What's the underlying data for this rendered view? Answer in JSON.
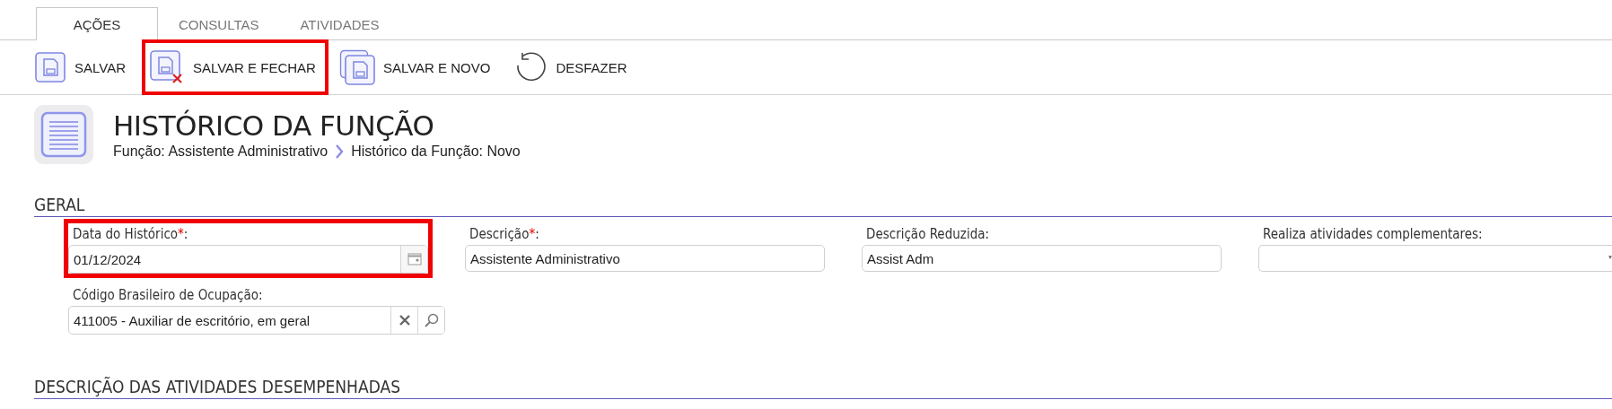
{
  "tabs": [
    {
      "label": "AÇÕES",
      "selected": true
    },
    {
      "label": "CONSULTAS",
      "selected": false
    },
    {
      "label": "ATIVIDADES",
      "selected": false
    }
  ],
  "toolbar": [
    {
      "kind": "save",
      "label": "SALVAR",
      "highlighted": false
    },
    {
      "kind": "save-close",
      "label": "SALVAR E FECHAR",
      "highlighted": true
    },
    {
      "kind": "save-new",
      "label": "SALVAR E NOVO",
      "highlighted": false
    },
    {
      "kind": "undo",
      "label": "DESFAZER",
      "highlighted": false
    }
  ],
  "header": {
    "title": "HISTÓRICO DA FUNÇÃO",
    "breadcrumb": [
      "Função: Assistente Administrativo",
      "Histórico da Função: Novo"
    ]
  },
  "sections": [
    {
      "title": "GERAL",
      "rows": [
        [
          {
            "kind": "date",
            "label": "Data do Histórico",
            "required_mark": "*",
            "label_suffix": ":",
            "value": "01/12/2024",
            "highlighted": true
          },
          {
            "kind": "text",
            "label": "Descrição",
            "required_mark": "*",
            "label_suffix": ":",
            "value": "Assistente Administrativo",
            "highlighted": false
          },
          {
            "kind": "text",
            "label": "Descrição Reduzida:",
            "value": "Assist Adm",
            "highlighted": false
          },
          {
            "kind": "select",
            "label": "Realiza atividades complementares:",
            "highlighted": false
          }
        ],
        [
          {
            "kind": "lookup",
            "label": "Código Brasileiro de Ocupação:",
            "value": "411005 - Auxiliar de escritório, em geral",
            "highlighted": false
          }
        ]
      ]
    },
    {
      "title": "DESCRIÇÃO DAS ATIVIDADES DESEMPENHADAS"
    }
  ]
}
